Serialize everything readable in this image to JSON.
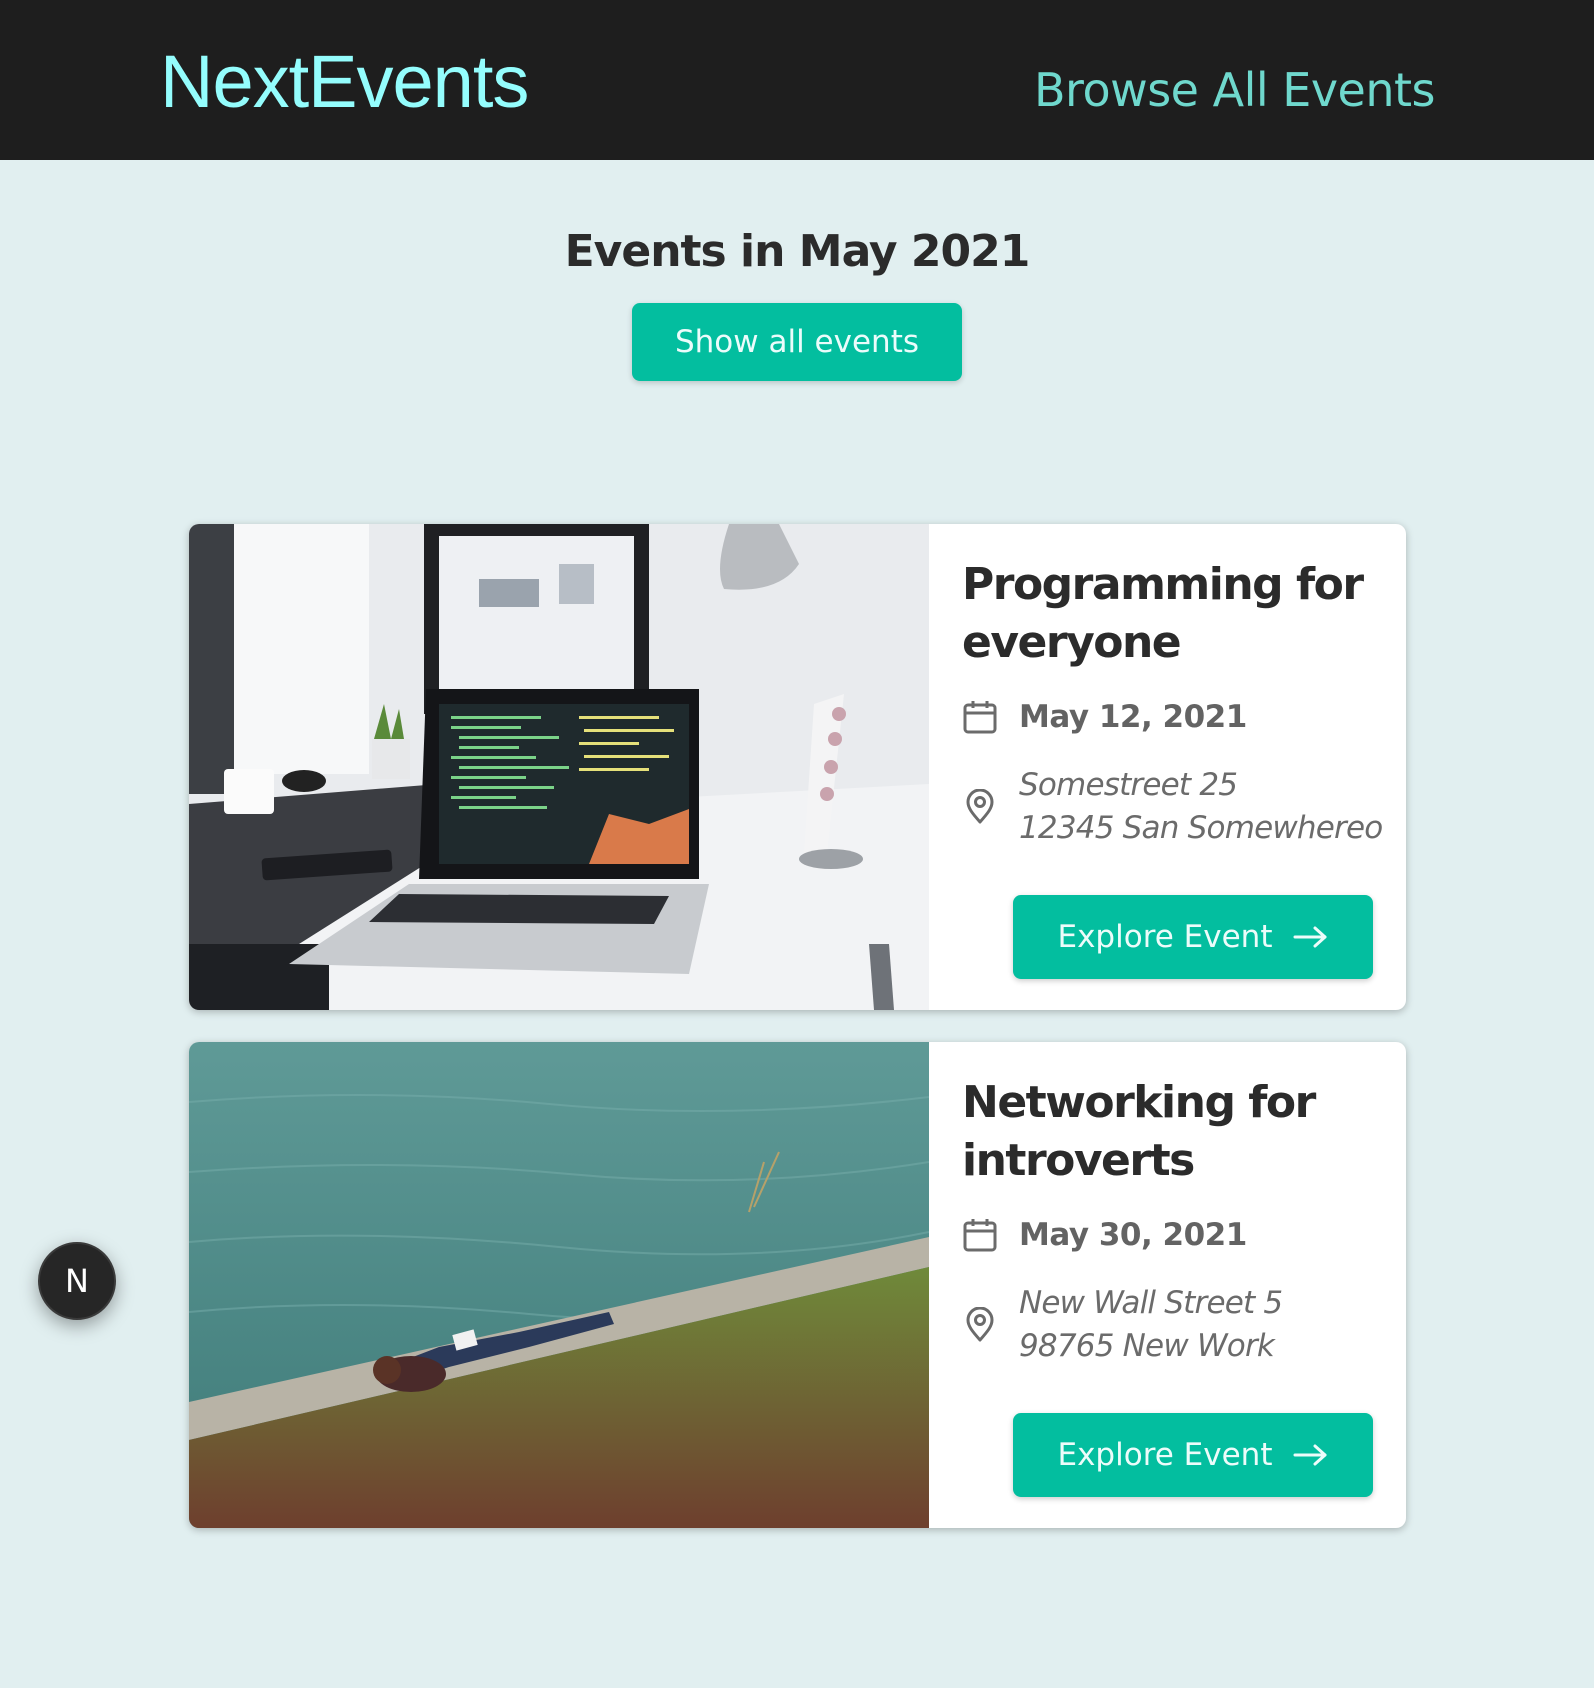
{
  "header": {
    "logo": "NextEvents",
    "nav_link": "Browse All Events"
  },
  "page": {
    "title": "Events in May 2021",
    "show_all_label": "Show all events"
  },
  "events": [
    {
      "title": "Programming for everyone",
      "date": "May 12, 2021",
      "address_line1": "Somestreet 25",
      "address_line2": "12345 San Somewhereo",
      "button_label": "Explore Event",
      "image": "photo of a desk with a laptop showing code and a monitor"
    },
    {
      "title": "Networking for introverts",
      "date": "May 30, 2021",
      "address_line1": "New Wall Street 5",
      "address_line2": "98765 New Work",
      "button_label": "Explore Event",
      "image": "photo of a person lying on grass reading by the water"
    }
  ],
  "badge": {
    "letter": "N"
  },
  "colors": {
    "header_bg": "#1e1e1e",
    "logo": "#94fdfd",
    "nav_link": "#6fd8cd",
    "page_bg": "#e1eff0",
    "accent": "#03be9f"
  },
  "icons": [
    "calendar-icon",
    "location-pin-icon",
    "arrow-right-icon"
  ]
}
